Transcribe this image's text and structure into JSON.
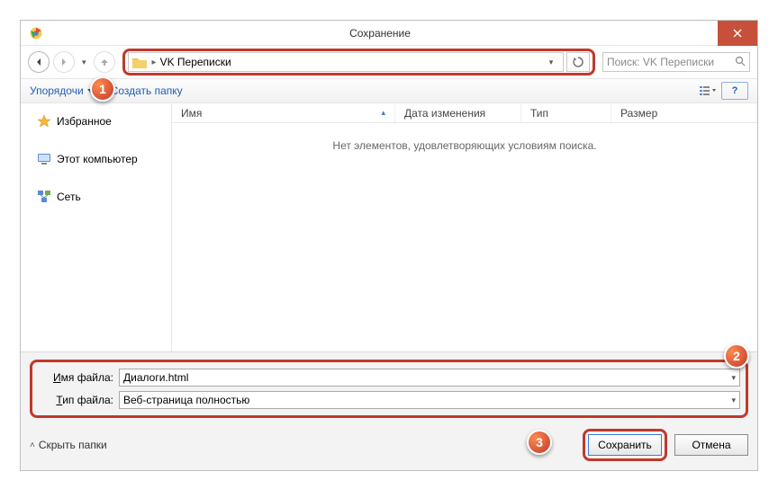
{
  "title": "Сохранение",
  "nav": {
    "address": "VK Переписки",
    "search_placeholder": "Поиск: VK Переписки"
  },
  "toolbar": {
    "organize": "Упорядочи",
    "new_folder": "Создать папку"
  },
  "sidebar": {
    "favorites": "Избранное",
    "computer": "Этот компьютер",
    "network": "Сеть"
  },
  "columns": {
    "name": "Имя",
    "date": "Дата изменения",
    "type": "Тип",
    "size": "Размер"
  },
  "empty": "Нет элементов, удовлетворяющих условиям поиска.",
  "file": {
    "name_label_prefix": "И",
    "name_label_rest": "мя файла:",
    "name_value": "Диалоги.html",
    "type_label_prefix": "Т",
    "type_label_rest": "ип файла:",
    "type_value": "Веб-страница полностью"
  },
  "actions": {
    "hide": "Скрыть папки",
    "save": "Сохранить",
    "cancel": "Отмена"
  },
  "callouts": {
    "c1": "1",
    "c2": "2",
    "c3": "3"
  }
}
